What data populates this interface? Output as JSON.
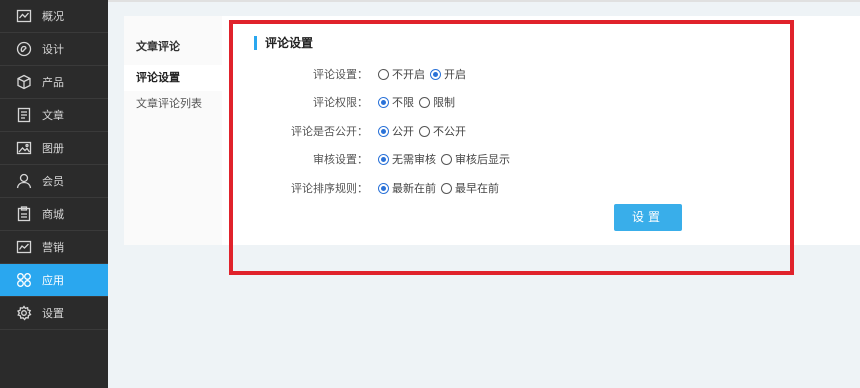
{
  "sidebar": {
    "items": [
      {
        "label": "概况",
        "icon": "chart-line-icon",
        "active": false
      },
      {
        "label": "设计",
        "icon": "palette-icon",
        "active": false
      },
      {
        "label": "产品",
        "icon": "box-icon",
        "active": false
      },
      {
        "label": "文章",
        "icon": "document-icon",
        "active": false
      },
      {
        "label": "图册",
        "icon": "image-icon",
        "active": false
      },
      {
        "label": "会员",
        "icon": "user-icon",
        "active": false
      },
      {
        "label": "商城",
        "icon": "clipboard-icon",
        "active": false
      },
      {
        "label": "营销",
        "icon": "trend-icon",
        "active": false
      },
      {
        "label": "应用",
        "icon": "apps-grid-icon",
        "active": true
      },
      {
        "label": "设置",
        "icon": "gear-icon",
        "active": false
      }
    ]
  },
  "subnav": {
    "title": "文章评论",
    "items": [
      {
        "label": "评论设置",
        "selected": true
      },
      {
        "label": "文章评论列表",
        "selected": false
      }
    ]
  },
  "content": {
    "title": "评论设置",
    "rows": [
      {
        "label": "评论设置：",
        "options": [
          {
            "text": "不开启",
            "checked": false
          },
          {
            "text": "开启",
            "checked": true
          }
        ]
      },
      {
        "label": "评论权限：",
        "options": [
          {
            "text": "不限",
            "checked": true
          },
          {
            "text": "限制",
            "checked": false
          }
        ]
      },
      {
        "label": "评论是否公开：",
        "options": [
          {
            "text": "公开",
            "checked": true
          },
          {
            "text": "不公开",
            "checked": false
          }
        ]
      },
      {
        "label": "审核设置：",
        "options": [
          {
            "text": "无需审核",
            "checked": true
          },
          {
            "text": "审核后显示",
            "checked": false
          }
        ]
      },
      {
        "label": "评论排序规则：",
        "options": [
          {
            "text": "最新在前",
            "checked": true
          },
          {
            "text": "最早在前",
            "checked": false
          }
        ]
      }
    ],
    "save_label": "设置"
  },
  "colors": {
    "accent": "#2aa7ef",
    "highlight_border": "#e0222b",
    "sidebar_bg": "#2b2b2b"
  }
}
